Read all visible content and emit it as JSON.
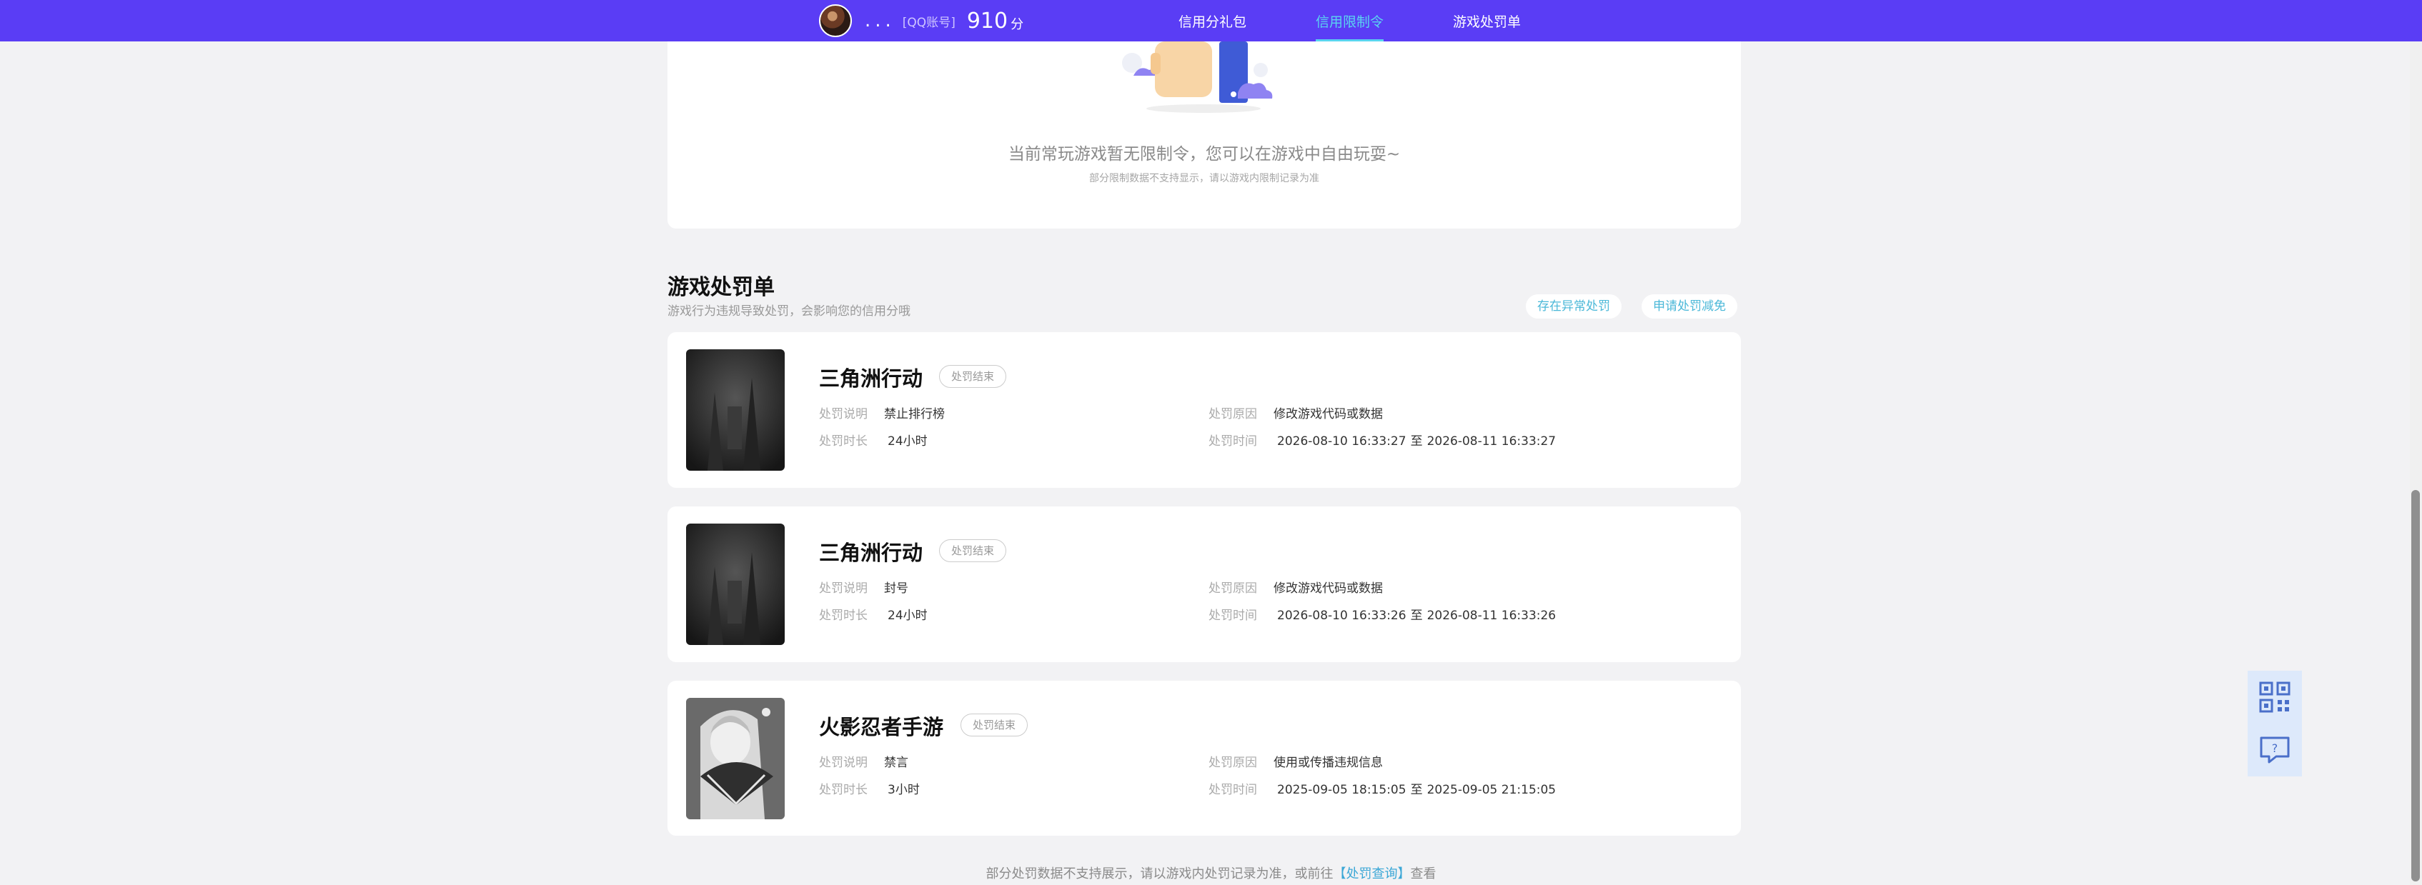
{
  "topbar": {
    "username": "...",
    "qq_label": "[QQ账号]",
    "score": "910",
    "score_unit": "分",
    "tabs": [
      {
        "label": "信用分礼包"
      },
      {
        "label": "信用限制令"
      },
      {
        "label": "游戏处罚单"
      }
    ],
    "active_tab": "信用限制令",
    "accent_color": "#5a3df5",
    "active_tab_color": "#5ad4f0"
  },
  "restriction_card": {
    "empty_title": "当前常玩游戏暂无限制令，您可以在游戏中自由玩耍~",
    "empty_subtitle": "部分限制数据不支持显示，请以游戏内限制记录为准"
  },
  "penalty_section": {
    "title": "游戏处罚单",
    "subtitle": "游戏行为违规导致处罚，会影响您的信用分哦",
    "actions": [
      {
        "label": "存在异常处罚"
      },
      {
        "label": "申请处罚减免"
      }
    ],
    "field_labels": {
      "description": "处罚说明",
      "duration": "处罚时长",
      "reason": "处罚原因",
      "time": "处罚时间"
    },
    "time_separator": "至",
    "records": [
      {
        "game": "三角洲行动",
        "status": "处罚结束",
        "description": "禁止排行榜",
        "duration": "24小时",
        "reason": "修改游戏代码或数据",
        "start": "2026-08-10 16:33:27",
        "end": "2026-08-11 16:33:27"
      },
      {
        "game": "三角洲行动",
        "status": "处罚结束",
        "description": "封号",
        "duration": "24小时",
        "reason": "修改游戏代码或数据",
        "start": "2026-08-10 16:33:26",
        "end": "2026-08-11 16:33:26"
      },
      {
        "game": "火影忍者手游",
        "status": "处罚结束",
        "description": "禁言",
        "duration": "3小时",
        "reason": "使用或传播违规信息",
        "start": "2025-09-05 18:15:05",
        "end": "2025-09-05 21:15:05"
      }
    ]
  },
  "footer": {
    "text_before": "部分处罚数据不支持展示，请以游戏内处罚记录为准，或前往",
    "link": "【处罚查询】",
    "text_after": "查看"
  },
  "side_buttons": [
    {
      "icon": "qr-code-icon"
    },
    {
      "icon": "feedback-question-icon"
    }
  ]
}
